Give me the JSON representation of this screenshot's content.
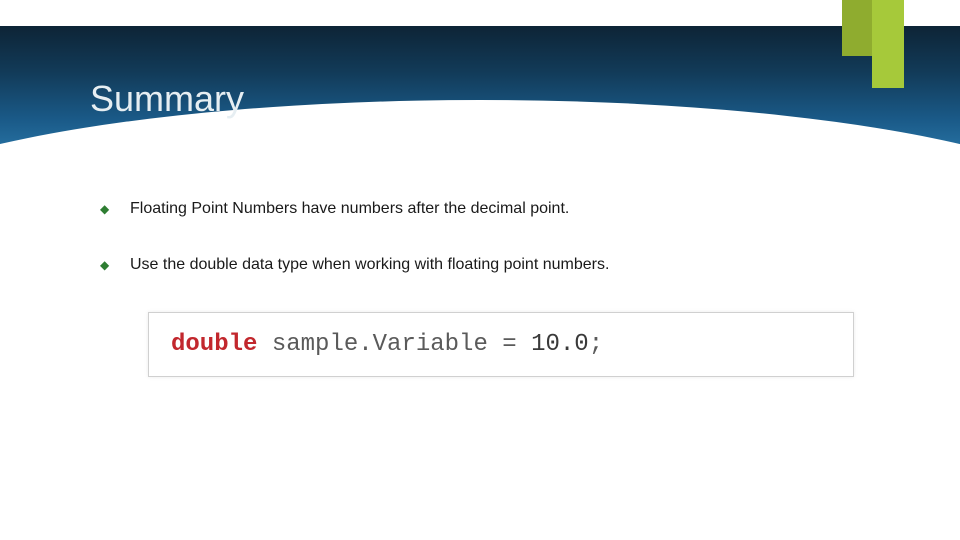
{
  "title": "Summary",
  "bullets": [
    "Floating Point Numbers have numbers after the decimal point.",
    "Use the double data type when working with floating point numbers."
  ],
  "code": {
    "keyword": "double",
    "identifier": "sample.Variable",
    "operator_eq": " = ",
    "value": "10.0",
    "terminator": ";"
  }
}
